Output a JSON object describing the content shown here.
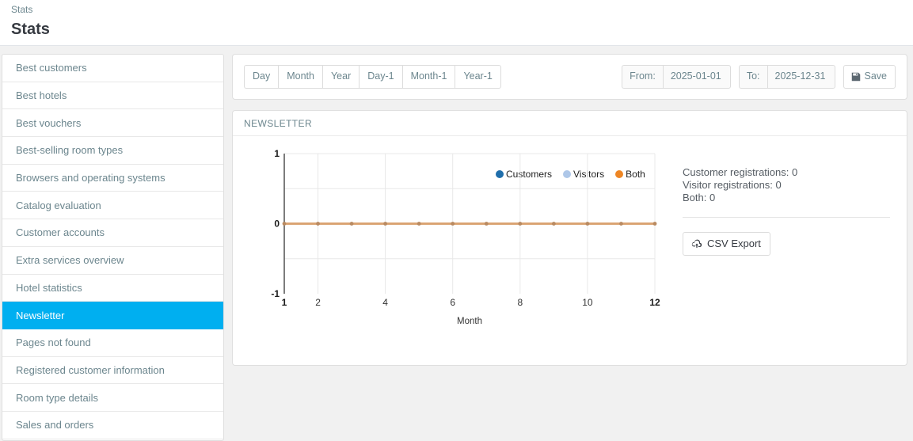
{
  "header": {
    "breadcrumb": "Stats",
    "title": "Stats"
  },
  "sidebar": {
    "items": [
      {
        "label": "Best customers",
        "active": false
      },
      {
        "label": "Best hotels",
        "active": false
      },
      {
        "label": "Best vouchers",
        "active": false
      },
      {
        "label": "Best-selling room types",
        "active": false
      },
      {
        "label": "Browsers and operating systems",
        "active": false
      },
      {
        "label": "Catalog evaluation",
        "active": false
      },
      {
        "label": "Customer accounts",
        "active": false
      },
      {
        "label": "Extra services overview",
        "active": false
      },
      {
        "label": "Hotel statistics",
        "active": false
      },
      {
        "label": "Newsletter",
        "active": true
      },
      {
        "label": "Pages not found",
        "active": false
      },
      {
        "label": "Registered customer information",
        "active": false
      },
      {
        "label": "Room type details",
        "active": false
      },
      {
        "label": "Sales and orders",
        "active": false
      }
    ]
  },
  "toolbar": {
    "range_buttons": [
      "Day",
      "Month",
      "Year",
      "Day-1",
      "Month-1",
      "Year-1"
    ],
    "from_label": "From:",
    "from_value": "2025-01-01",
    "to_label": "To:",
    "to_value": "2025-12-31",
    "save_label": "Save",
    "save_icon": "floppy-disk-icon"
  },
  "chart_panel": {
    "title": "NEWSLETTER",
    "stats": [
      "Customer registrations: 0",
      "Visitor registrations: 0",
      "Both: 0"
    ],
    "csv_export_label": "CSV Export",
    "csv_export_icon": "cloud-download-icon"
  },
  "colors": {
    "accent": "#00aff0",
    "customers": "#1f6eab",
    "visitors": "#aec7e8",
    "both": "#ee8624",
    "line": "#d9a271",
    "grid": "#e8e8e8",
    "axis": "#444444",
    "panel_border": "#dfdfdf",
    "page_bg": "#f1f1f1"
  },
  "chart_data": {
    "type": "line",
    "title": "NEWSLETTER",
    "xlabel": "Month",
    "ylabel": "",
    "x": [
      1,
      2,
      3,
      4,
      5,
      6,
      7,
      8,
      9,
      10,
      11,
      12
    ],
    "xticks": [
      1,
      2,
      4,
      6,
      8,
      10,
      12
    ],
    "xtick_labels": [
      "1",
      "2",
      "4",
      "6",
      "8",
      "10",
      "12"
    ],
    "yticks": [
      1,
      0,
      -1
    ],
    "ytick_labels": [
      "1",
      "0",
      "-1"
    ],
    "xlim": [
      1,
      12
    ],
    "ylim": [
      -1,
      1
    ],
    "grid": true,
    "legend_position": "top-right",
    "series": [
      {
        "name": "Customers",
        "color": "#1f6eab",
        "values": [
          0,
          0,
          0,
          0,
          0,
          0,
          0,
          0,
          0,
          0,
          0,
          0
        ]
      },
      {
        "name": "Visitors",
        "color": "#aec7e8",
        "values": [
          0,
          0,
          0,
          0,
          0,
          0,
          0,
          0,
          0,
          0,
          0,
          0
        ]
      },
      {
        "name": "Both",
        "color": "#ee8624",
        "values": [
          0,
          0,
          0,
          0,
          0,
          0,
          0,
          0,
          0,
          0,
          0,
          0
        ]
      }
    ]
  }
}
